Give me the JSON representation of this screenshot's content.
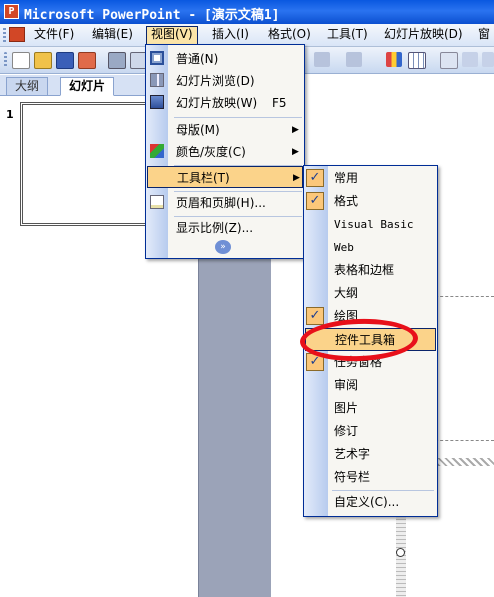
{
  "window": {
    "title": "Microsoft PowerPoint - [演示文稿1]",
    "icon": "powerpoint-app-icon"
  },
  "menubar": {
    "items": [
      {
        "label": "文件(F)",
        "active": false
      },
      {
        "label": "编辑(E)",
        "active": false
      },
      {
        "label": "视图(V)",
        "active": true
      },
      {
        "label": "插入(I)",
        "active": false
      },
      {
        "label": "格式(O)",
        "active": false
      },
      {
        "label": "工具(T)",
        "active": false
      },
      {
        "label": "幻灯片放映(D)",
        "active": false
      },
      {
        "label": "窗"
      }
    ]
  },
  "left_pane": {
    "tabs": [
      {
        "label": "大纲"
      },
      {
        "label": "幻灯片"
      }
    ],
    "close_glyph": "×",
    "slide_number": "1"
  },
  "view_menu": {
    "items": [
      {
        "label": "普通(N)",
        "icon": "normal-view-icon"
      },
      {
        "label": "幻灯片浏览(D)",
        "icon": "slide-sorter-icon"
      },
      {
        "label": "幻灯片放映(W)",
        "shortcut": "F5",
        "icon": "slideshow-icon"
      },
      {
        "label": "母版(M)",
        "submenu": true
      },
      {
        "label": "颜色/灰度(C)",
        "submenu": true,
        "icon": "color-grayscale-icon"
      },
      {
        "label": "工具栏(T)",
        "submenu": true,
        "highlighted": true
      },
      {
        "label": "页眉和页脚(H)...",
        "icon": "header-footer-icon"
      },
      {
        "label": "显示比例(Z)..."
      }
    ],
    "expand_glyph": "»"
  },
  "toolbars_submenu": {
    "items": [
      {
        "label": "常用",
        "checked": true
      },
      {
        "label": "格式",
        "checked": true
      },
      {
        "label": "Visual Basic",
        "checked": false
      },
      {
        "label": "Web",
        "checked": false
      },
      {
        "label": "表格和边框",
        "checked": false
      },
      {
        "label": "大纲",
        "checked": false
      },
      {
        "label": "绘图",
        "checked": true
      },
      {
        "label": "控件工具箱",
        "checked": false,
        "highlighted": true
      },
      {
        "label": "任务窗格",
        "checked": true
      },
      {
        "label": "审阅",
        "checked": false
      },
      {
        "label": "图片",
        "checked": false
      },
      {
        "label": "修订",
        "checked": false
      },
      {
        "label": "艺术字",
        "checked": false
      },
      {
        "label": "符号栏",
        "checked": false
      },
      {
        "label": "自定义(C)...",
        "checked": false
      }
    ],
    "check_glyph": "✓"
  },
  "annotation": {
    "color": "#e8101a",
    "target": "控件工具箱"
  },
  "colors": {
    "title_bar": "#0a58e0",
    "menu_highlight": "#fbd38a",
    "check_bg": "#fbc77a",
    "menu_border": "#002d96"
  }
}
